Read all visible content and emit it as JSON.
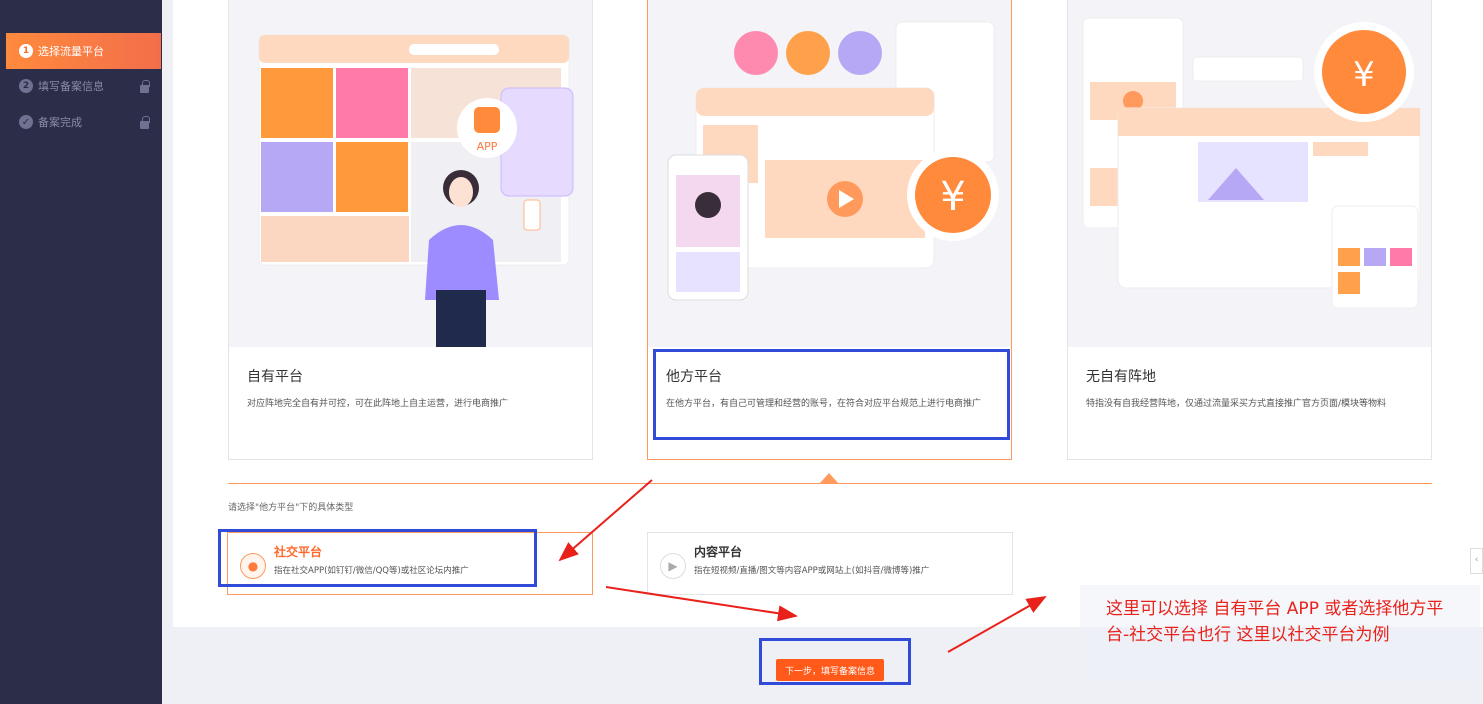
{
  "sidebar": {
    "steps": [
      {
        "num": "1",
        "label": "选择流量平台",
        "state": "active"
      },
      {
        "num": "2",
        "label": "填写备案信息",
        "state": "locked"
      },
      {
        "num": "✓",
        "label": "备案完成",
        "state": "locked"
      }
    ]
  },
  "platforms": [
    {
      "title": "自有平台",
      "desc": "对应阵地完全自有并可控，可在此阵地上自主运营，进行电商推广",
      "selected": false
    },
    {
      "title": "他方平台",
      "desc": "在他方平台，有自己可管理和经营的账号，在符合对应平台规范上进行电商推广",
      "selected": true
    },
    {
      "title": "无自有阵地",
      "desc": "特指没有自我经营阵地，仅通过流量采买方式直接推广官方页面/模块等物料",
      "selected": false
    }
  ],
  "illustration_text": {
    "app_badge": "APP",
    "yen": "¥"
  },
  "subtype_prompt": "请选择\"他方平台\"下的具体类型",
  "subtypes": [
    {
      "title": "社交平台",
      "desc": "指在社交APP(如钉钉/微信/QQ等)或社区论坛内推广",
      "icon": "chat-bubble-icon",
      "selected": true
    },
    {
      "title": "内容平台",
      "desc": "指在短视频/直播/图文等内容APP或网站上(如抖音/微博等)推广",
      "icon": "video-icon",
      "selected": false
    }
  ],
  "next_button": "下一步，填写备案信息",
  "annotation": "这里可以选择  自有平台 APP    或者选择他方平台-社交平台也行     这里以社交平台为例",
  "colors": {
    "accent": "#ff6a2c",
    "sidebar": "#2c2d48",
    "highlight_box": "#2f4bd8",
    "annotation": "#e8221b"
  }
}
